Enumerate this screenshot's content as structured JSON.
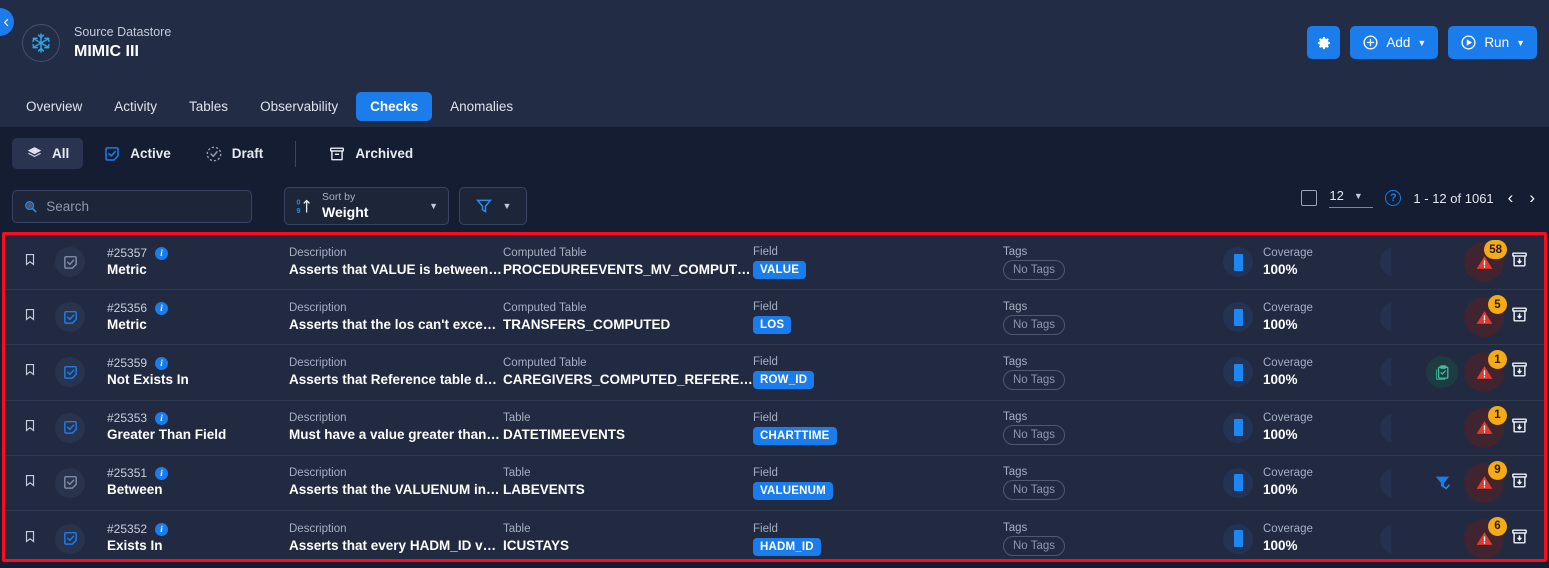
{
  "header": {
    "datastore_label": "Source Datastore",
    "datastore_name": "MIMIC III",
    "collapse_icon": "chevron-left-icon",
    "logo_icon": "snowflake-icon",
    "actions": {
      "settings_icon": "gear-icon",
      "add_label": "Add",
      "add_icon": "plus-circle-icon",
      "run_label": "Run",
      "run_icon": "play-circle-icon",
      "caret_icon": "chevron-down-icon"
    }
  },
  "nav_tabs": [
    {
      "label": "Overview",
      "active": false
    },
    {
      "label": "Activity",
      "active": false
    },
    {
      "label": "Tables",
      "active": false
    },
    {
      "label": "Observability",
      "active": false
    },
    {
      "label": "Checks",
      "active": true
    },
    {
      "label": "Anomalies",
      "active": false
    }
  ],
  "filters": [
    {
      "label": "All",
      "icon": "layers-icon",
      "active": true
    },
    {
      "label": "Active",
      "icon": "checkbox-checked-icon",
      "active": false
    },
    {
      "label": "Draft",
      "icon": "dashed-circle-check-icon",
      "active": false
    },
    {
      "label": "Archived",
      "icon": "archive-box-icon",
      "active": false
    }
  ],
  "search": {
    "placeholder": "Search",
    "icon": "search-icon",
    "value": ""
  },
  "sort": {
    "label": "Sort by",
    "value": "Weight",
    "icon": "sort-ascending-icon",
    "caret": "chevron-down-icon"
  },
  "filter_button": {
    "icon": "funnel-icon",
    "caret": "chevron-down-icon"
  },
  "pagination": {
    "select_all_checkbox": false,
    "page_size": "12",
    "help_icon": "question-mark-icon",
    "range_text": "1 - 12 of 1061",
    "prev_icon": "chevron-left-icon",
    "next_icon": "chevron-right-icon"
  },
  "columns": {
    "description": "Description",
    "computed_table": "Computed Table",
    "table": "Table",
    "field": "Field",
    "tags": "Tags",
    "coverage": "Coverage"
  },
  "rows": [
    {
      "id": "#25357",
      "rule_type": "Metric",
      "state": "draft",
      "description": "Asserts that VALUE is between MI...",
      "table_label": "Computed Table",
      "table": "PROCEDUREEVENTS_MV_COMPUTED",
      "field": "VALUE",
      "tags": "No Tags",
      "coverage": "100%",
      "extra_icon": "",
      "warning_count": "58"
    },
    {
      "id": "#25356",
      "rule_type": "Metric",
      "state": "active",
      "description": "Asserts that the los can't exceed t...",
      "table_label": "Computed Table",
      "table": "TRANSFERS_COMPUTED",
      "field": "LOS",
      "tags": "No Tags",
      "coverage": "100%",
      "extra_icon": "",
      "warning_count": "5"
    },
    {
      "id": "#25359",
      "rule_type": "Not Exists In",
      "state": "active",
      "description": "Asserts that Reference table does ...",
      "table_label": "Computed Table",
      "table": "CAREGIVERS_COMPUTED_REFERENCE",
      "field": "ROW_ID",
      "tags": "No Tags",
      "coverage": "100%",
      "extra_icon": "clipboard-check-icon",
      "warning_count": "1"
    },
    {
      "id": "#25353",
      "rule_type": "Greater Than Field",
      "state": "active",
      "description": "Must have a value greater than or ...",
      "table_label": "Table",
      "table": "DATETIMEEVENTS",
      "field": "CHARTTIME",
      "tags": "No Tags",
      "coverage": "100%",
      "extra_icon": "",
      "warning_count": "1"
    },
    {
      "id": "#25351",
      "rule_type": "Between",
      "state": "draft",
      "description": "Asserts that the VALUENUM in the ...",
      "table_label": "Table",
      "table": "LABEVENTS",
      "field": "VALUENUM",
      "tags": "No Tags",
      "coverage": "100%",
      "extra_icon": "filter-check-icon",
      "warning_count": "9"
    },
    {
      "id": "#25352",
      "rule_type": "Exists In",
      "state": "active",
      "description": "Asserts that every HADM_ID value ...",
      "table_label": "Table",
      "table": "ICUSTAYS",
      "field": "HADM_ID",
      "tags": "No Tags",
      "coverage": "100%",
      "extra_icon": "",
      "warning_count": "6"
    }
  ],
  "colors": {
    "accent": "#1b7ceb",
    "background": "#151d33",
    "panel": "#222c44",
    "row": "#212a40",
    "highlight_border": "#fc0d1b",
    "badge": "#f5ab16",
    "warning": "#e23a2e"
  }
}
